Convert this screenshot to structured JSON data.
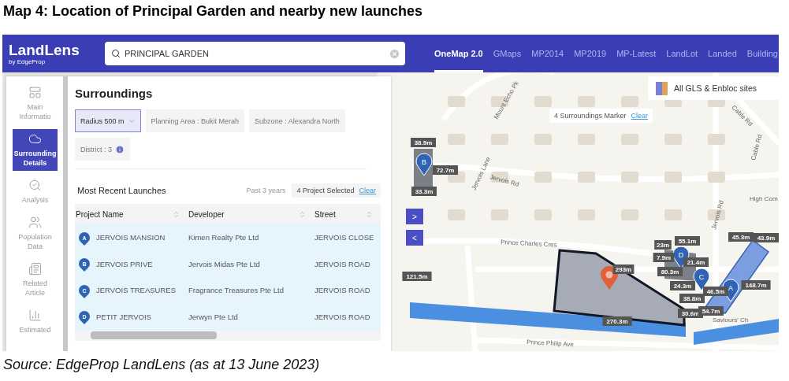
{
  "page_title": "Map 4: Location of Principal Garden and nearby new launches",
  "app": {
    "logo": {
      "name": "LandLens",
      "byline": "by EdgeProp"
    },
    "search": {
      "value": "PRINCIPAL GARDEN"
    },
    "map_tabs": [
      {
        "label": "OneMap 2.0",
        "selected": true
      },
      {
        "label": "GMaps",
        "selected": false
      },
      {
        "label": "MP2014",
        "selected": false
      },
      {
        "label": "MP2019",
        "selected": false
      },
      {
        "label": "MP-Latest",
        "selected": false
      },
      {
        "label": "LandLot",
        "selected": false
      },
      {
        "label": "Landed",
        "selected": false
      },
      {
        "label": "Building",
        "selected": false
      }
    ],
    "sidebar": {
      "items": [
        {
          "label": "Main Informatio",
          "kind": "layout",
          "selected": false
        },
        {
          "label": "Surrounding Details",
          "kind": "cloud",
          "selected": true
        },
        {
          "label": "Analysis",
          "kind": "analysis",
          "selected": false
        },
        {
          "label": "Population Data",
          "kind": "people",
          "selected": false
        },
        {
          "label": "Related Article",
          "kind": "article",
          "selected": false
        },
        {
          "label": "Estimated",
          "kind": "chart",
          "selected": false
        }
      ]
    },
    "surroundings": {
      "title": "Surroundings",
      "filters": [
        {
          "label": "Radius 500 m",
          "kind": "dropdown",
          "selected": true
        },
        {
          "label": "Planning Area : Bukit Merah",
          "kind": "chip",
          "selected": false
        },
        {
          "label": "Subzone : Alexandra North",
          "kind": "chip",
          "selected": false
        },
        {
          "label": "District : 3",
          "kind": "info",
          "selected": false
        }
      ]
    },
    "launches": {
      "title": "Most Recent Launches",
      "period": "Past 3 years",
      "selection": "4 Project Selected",
      "clear": "Clear",
      "columns": [
        "Project Name",
        "Developer",
        "Street"
      ],
      "rows": [
        {
          "marker": "A",
          "project": "JERVOIS MANSION",
          "developer": "Kimen Realty Pte Ltd",
          "street": "JERVOIS CLOSE",
          "selected": true
        },
        {
          "marker": "B",
          "project": "JERVOIS PRIVE",
          "developer": "Jervois Midas Pte Ltd",
          "street": "JERVOIS ROAD",
          "selected": true
        },
        {
          "marker": "C",
          "project": "JERVOIS TREASURES",
          "developer": "Fragrance Treasures Pte Ltd",
          "street": "JERVOIS ROAD",
          "selected": true
        },
        {
          "marker": "D",
          "project": "PETIT JERVOIS",
          "developer": "Jerwyn Pte Ltd",
          "street": "JERVOIS ROAD",
          "selected": true
        }
      ]
    },
    "panel_controls": [
      ">",
      "<"
    ],
    "map": {
      "layers_button": "All GLS & Enbloc sites",
      "marker_count": "4 Surroundings Marker",
      "clear": "Clear",
      "street_labels": [
        "Mount Echo Pk",
        "Jervois Rd",
        "Cable Rd",
        "Cable Rd",
        "Jervois Lane",
        "Prince Charles Cres",
        "Prince Philip Ave",
        "Jervois Rd",
        "Saviours' Ch",
        "High Com"
      ],
      "distance_labels": [
        "38.9m",
        "72.7m",
        "33.3m",
        "121.5m",
        "293m",
        "270.3m",
        "23m",
        "55.1m",
        "7.9m",
        "21.4m",
        "80.3m",
        "24.3m",
        "38.8m",
        "46.5m",
        "30.6m",
        "54.7m",
        "45.3m",
        "43.9m",
        "148.7m"
      ],
      "markers": [
        "B",
        "D",
        "C",
        "A"
      ]
    }
  },
  "caption": "Source: EdgeProp LandLens (as at 13 June 2023)"
}
